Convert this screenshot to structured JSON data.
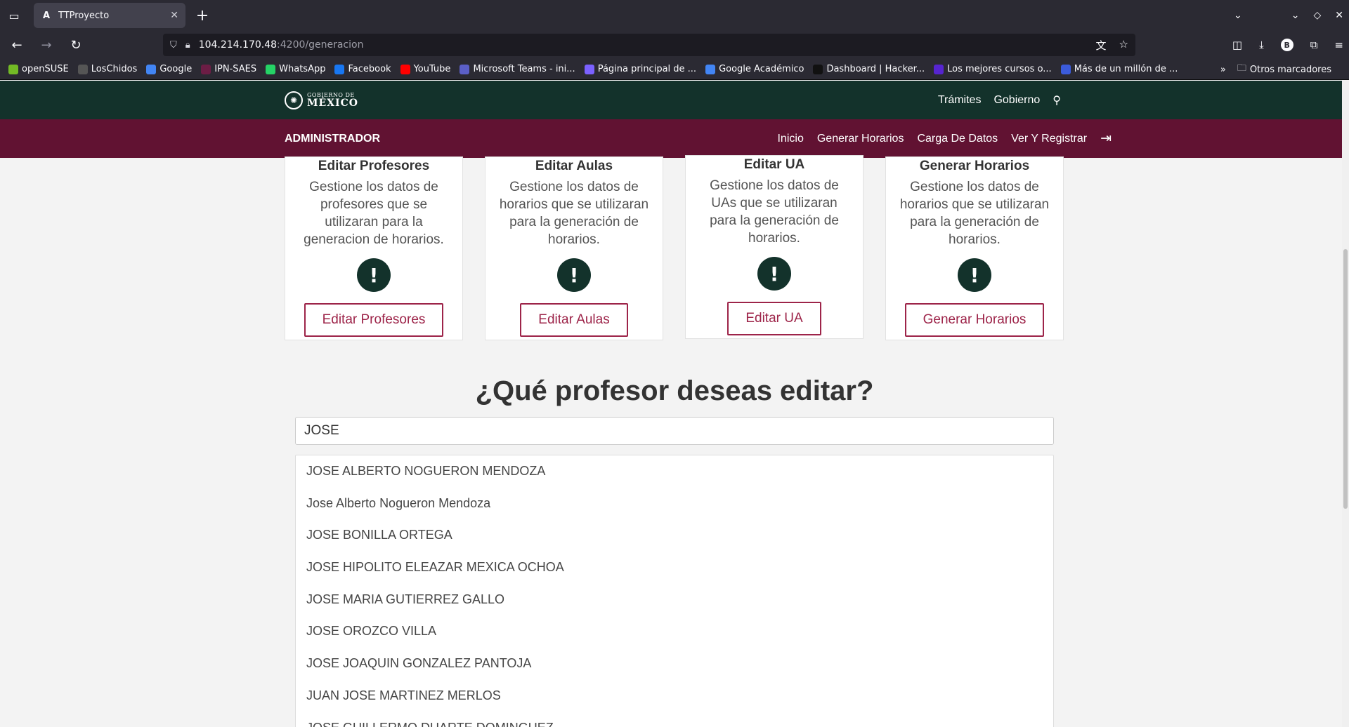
{
  "browser": {
    "tab_title": "TTProyecto",
    "tab_favicon": "A",
    "url_host": "104.214.170.48",
    "url_path": ":4200/generacion",
    "bookmarks": [
      {
        "label": "openSUSE",
        "color": "#73ba25"
      },
      {
        "label": "LosChidos",
        "color": "#555555"
      },
      {
        "label": "Google",
        "color": "#4285f4"
      },
      {
        "label": "IPN-SAES",
        "color": "#6c1d45"
      },
      {
        "label": "WhatsApp",
        "color": "#25d366"
      },
      {
        "label": "Facebook",
        "color": "#1877f2"
      },
      {
        "label": "YouTube",
        "color": "#ff0000"
      },
      {
        "label": "Microsoft Teams - ini...",
        "color": "#5b5fc7"
      },
      {
        "label": "Página principal de ...",
        "color": "#7b61ff"
      },
      {
        "label": "Google Académico",
        "color": "#4285f4"
      },
      {
        "label": "Dashboard | Hacker...",
        "color": "#111111"
      },
      {
        "label": "Los mejores cursos o...",
        "color": "#5624d0"
      },
      {
        "label": "Más de un millón de ...",
        "color": "#3b5bdb"
      }
    ],
    "other_bookmarks": "Otros marcadores"
  },
  "gov_header": {
    "logo_small": "GOBIERNO DE",
    "logo_big": "MÉXICO",
    "links": [
      "Trámites",
      "Gobierno"
    ]
  },
  "admin_bar": {
    "title": "ADMINISTRADOR",
    "links": [
      "Inicio",
      "Generar Horarios",
      "Carga De Datos",
      "Ver Y Registrar"
    ]
  },
  "cards": [
    {
      "title": "Editar Profesores",
      "description": "Gestione los datos de profesores que se utilizaran para la generacion de horarios.",
      "button": "Editar Profesores"
    },
    {
      "title": "Editar Aulas",
      "description": "Gestione los datos de horarios que se utilizaran para la generación de horarios.",
      "button": "Editar Aulas"
    },
    {
      "title": "Editar UA",
      "description": "Gestione los datos de UAs que se utilizaran para la generación de horarios.",
      "button": "Editar UA"
    },
    {
      "title": "Generar Horarios",
      "description": "Gestione los datos de horarios que se utilizaran para la generación de horarios.",
      "button": "Generar Horarios"
    }
  ],
  "search": {
    "question": "¿Qué profesor deseas editar?",
    "value": "JOSE",
    "results": [
      "JOSE ALBERTO NOGUERON MENDOZA",
      "Jose Alberto Nogueron Mendoza",
      "JOSE BONILLA ORTEGA",
      "JOSE HIPOLITO ELEAZAR MEXICA OCHOA",
      "JOSE MARIA GUTIERREZ GALLO",
      "JOSE OROZCO VILLA",
      "JOSE JOAQUIN GONZALEZ PANTOJA",
      "JUAN JOSE MARTINEZ MERLOS",
      "JOSE GUILLERMO DUARTE DOMINGUEZ"
    ]
  },
  "colors": {
    "gov_green": "#13322b",
    "gov_maroon": "#611232",
    "accent": "#9d2449"
  }
}
